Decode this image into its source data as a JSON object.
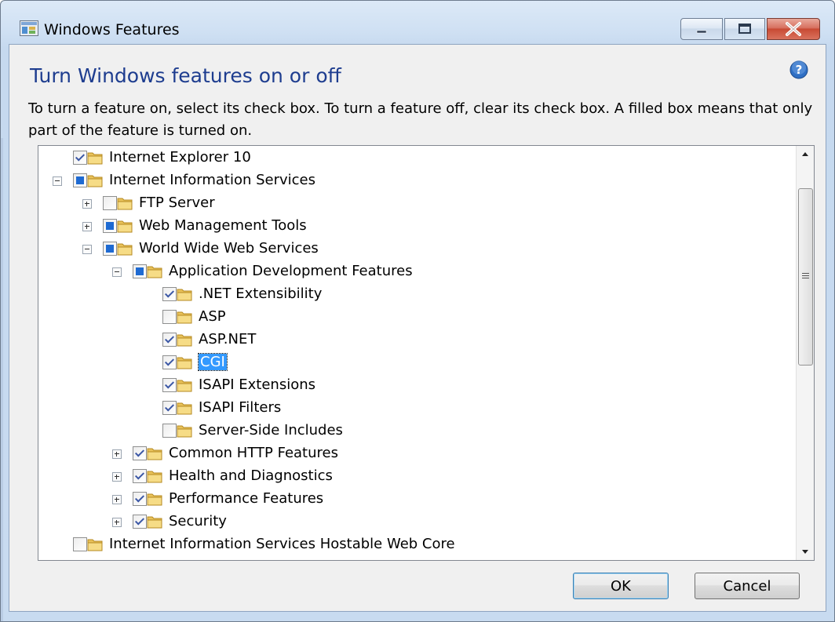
{
  "window": {
    "title": "Windows Features"
  },
  "header": {
    "heading": "Turn Windows features on or off",
    "description": "To turn a feature on, select its check box. To turn a feature off, clear its check box. A filled box means that only part of the feature is turned on."
  },
  "tree": {
    "items": [
      {
        "label": "Internet Explorer 10",
        "level": 0,
        "expander": "none",
        "state": "checked"
      },
      {
        "label": "Internet Information Services",
        "level": 0,
        "expander": "minus",
        "state": "partial"
      },
      {
        "label": "FTP Server",
        "level": 1,
        "expander": "plus",
        "state": "unchecked"
      },
      {
        "label": "Web Management Tools",
        "level": 1,
        "expander": "plus",
        "state": "partial"
      },
      {
        "label": "World Wide Web Services",
        "level": 1,
        "expander": "minus",
        "state": "partial"
      },
      {
        "label": "Application Development Features",
        "level": 2,
        "expander": "minus",
        "state": "partial"
      },
      {
        "label": ".NET Extensibility",
        "level": 3,
        "expander": "none",
        "state": "checked"
      },
      {
        "label": "ASP",
        "level": 3,
        "expander": "none",
        "state": "unchecked"
      },
      {
        "label": "ASP.NET",
        "level": 3,
        "expander": "none",
        "state": "checked"
      },
      {
        "label": "CGI",
        "level": 3,
        "expander": "none",
        "state": "checked",
        "selected": true
      },
      {
        "label": "ISAPI Extensions",
        "level": 3,
        "expander": "none",
        "state": "checked"
      },
      {
        "label": "ISAPI Filters",
        "level": 3,
        "expander": "none",
        "state": "checked"
      },
      {
        "label": "Server-Side Includes",
        "level": 3,
        "expander": "none",
        "state": "unchecked"
      },
      {
        "label": "Common HTTP Features",
        "level": 2,
        "expander": "plus",
        "state": "checked"
      },
      {
        "label": "Health and Diagnostics",
        "level": 2,
        "expander": "plus",
        "state": "checked"
      },
      {
        "label": "Performance Features",
        "level": 2,
        "expander": "plus",
        "state": "checked"
      },
      {
        "label": "Security",
        "level": 2,
        "expander": "plus",
        "state": "checked"
      },
      {
        "label": "Internet Information Services Hostable Web Core",
        "level": 0,
        "expander": "none",
        "state": "unchecked"
      }
    ]
  },
  "buttons": {
    "ok": "OK",
    "cancel": "Cancel"
  },
  "icons": {
    "app": "windows-features-icon",
    "help": "help-icon",
    "folder": "folder-icon"
  },
  "colors": {
    "heading": "#1e3d8f",
    "selection": "#3399ff",
    "partial_fill": "#1e6ad2",
    "close_button": "#c84a34"
  }
}
